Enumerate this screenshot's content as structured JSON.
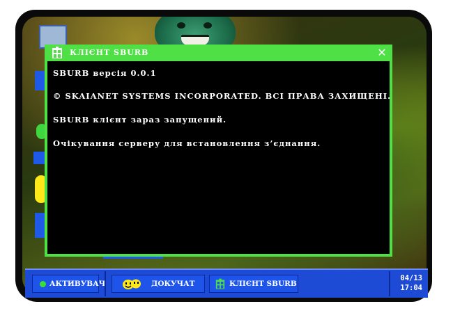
{
  "window": {
    "title": "КЛІЄНТ SBURB",
    "close_glyph": "✕"
  },
  "terminal": {
    "lines": [
      "SBURB версія 0.0.1",
      "© SKAIANET SYSTEMS INCORPORATED. ВСІ ПРАВА ЗАХИЩЕНІ.",
      "SBURB клієнт зараз запущений.",
      "Очікування серверу для встановлення з’єднання."
    ]
  },
  "taskbar": {
    "start_label": "АКТИВУВАЧ",
    "apps": [
      {
        "label": "ДОКУЧАТ",
        "icon": "pesterchum-icon"
      },
      {
        "label": "КЛІЄНТ SBURB",
        "icon": "sburb-house-icon"
      }
    ],
    "clock": {
      "date": "04/13",
      "time": "17:04"
    }
  },
  "colors": {
    "window_green": "#4ee044",
    "taskbar_blue": "#1d4bd6",
    "terminal_bg": "#000000",
    "start_indicator": "#39e03a",
    "pesterchum_yellow": "#ffe81a"
  }
}
